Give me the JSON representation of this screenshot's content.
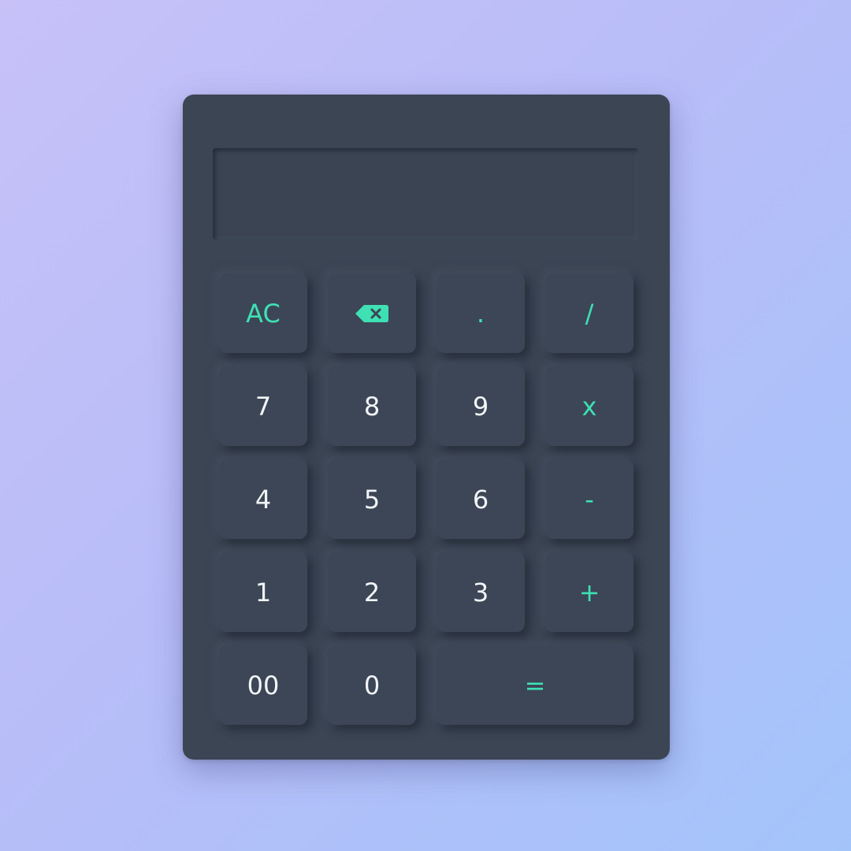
{
  "calculator": {
    "display_value": "",
    "accent_color": "#3ee0b4",
    "body_color": "#3b4554",
    "keys": {
      "clear": "AC",
      "backspace_icon": "backspace-icon",
      "decimal": ".",
      "divide": "/",
      "seven": "7",
      "eight": "8",
      "nine": "9",
      "multiply": "x",
      "four": "4",
      "five": "5",
      "six": "6",
      "subtract": "-",
      "one": "1",
      "two": "2",
      "three": "3",
      "add": "+",
      "double_zero": "00",
      "zero": "0",
      "equals": "="
    }
  }
}
